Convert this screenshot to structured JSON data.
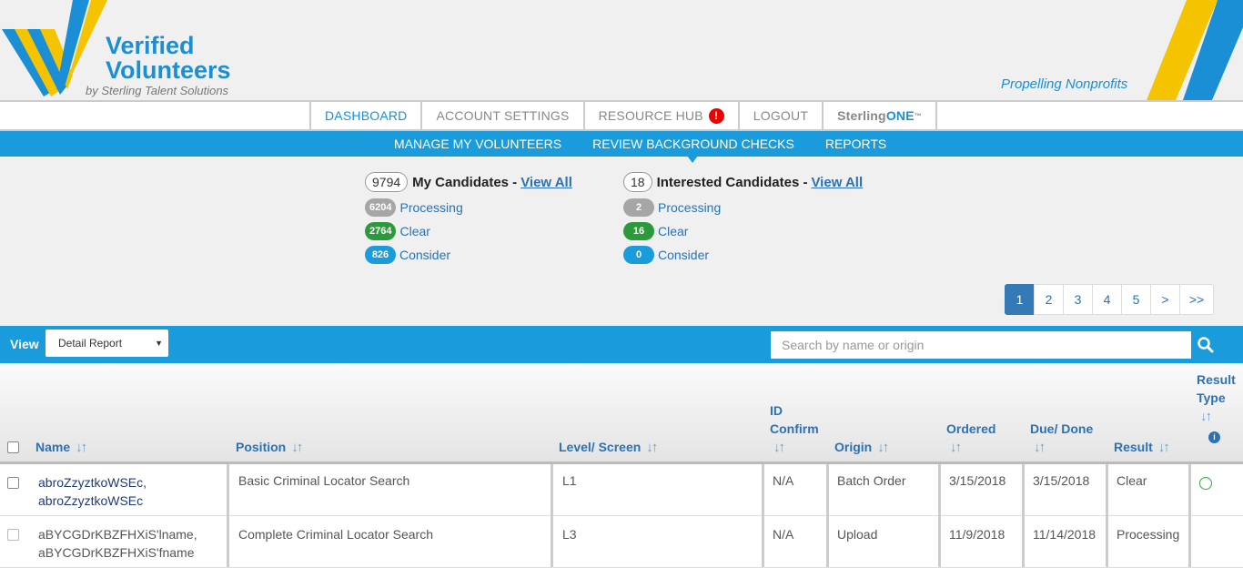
{
  "header": {
    "brand_line1": "Verified",
    "brand_line2": "Volunteers",
    "brand_sub": "by Sterling Talent Solutions",
    "tagline": "Propelling Nonprofits"
  },
  "topnav": {
    "dashboard": "DASHBOARD",
    "account_settings": "ACCOUNT SETTINGS",
    "resource_hub": "RESOURCE HUB",
    "resource_hub_alert": "!",
    "logout": "LOGOUT",
    "sterling_a": "Sterling",
    "sterling_b": "ONE",
    "sterling_tm": "™"
  },
  "subnav": {
    "manage": "MANAGE MY VOLUNTEERS",
    "review": "REVIEW BACKGROUND CHECKS",
    "reports": "REPORTS"
  },
  "my_candidates": {
    "count": "9794",
    "title": "My Candidates -",
    "link": "View All",
    "processing_count": "6204",
    "processing_label": "Processing",
    "clear_count": "2764",
    "clear_label": "Clear",
    "consider_count": "826",
    "consider_label": "Consider"
  },
  "interested_candidates": {
    "count": "18",
    "title": "Interested Candidates -",
    "link": "View All",
    "processing_count": "2",
    "processing_label": "Processing",
    "clear_count": "16",
    "clear_label": "Clear",
    "consider_count": "0",
    "consider_label": "Consider"
  },
  "pager": [
    "1",
    "2",
    "3",
    "4",
    "5",
    ">",
    ">>"
  ],
  "toolbar": {
    "view_label": "View",
    "view_value": "Detail Report",
    "search_placeholder": "Search by name or origin"
  },
  "columns": {
    "name": "Name",
    "position": "Position",
    "level": "Level/ Screen",
    "id_confirm_1": "ID",
    "id_confirm_2": "Confirm",
    "origin": "Origin",
    "ordered": "Ordered",
    "due_1": "Due/ Done",
    "result": "Result",
    "result_type_1": "Result",
    "result_type_2": "Type",
    "sort_glyph": "↓↑"
  },
  "rows": [
    {
      "name_1": "abroZzyztkoWSEc,",
      "name_2": "abroZzyztkoWSEc",
      "position": "Basic Criminal Locator Search",
      "level": "L1",
      "id_confirm": "N/A",
      "origin": "Batch Order",
      "ordered": "3/15/2018",
      "due": "3/15/2018",
      "result": "Clear"
    },
    {
      "name_1": "aBYCGDrKBZFHXiS'lname,",
      "name_2": "aBYCGDrKBZFHXiS'fname",
      "position": "Complete Criminal Locator Search",
      "level": "L3",
      "id_confirm": "N/A",
      "origin": "Upload",
      "ordered": "11/9/2018",
      "due": "11/14/2018",
      "result": "Processing"
    }
  ]
}
